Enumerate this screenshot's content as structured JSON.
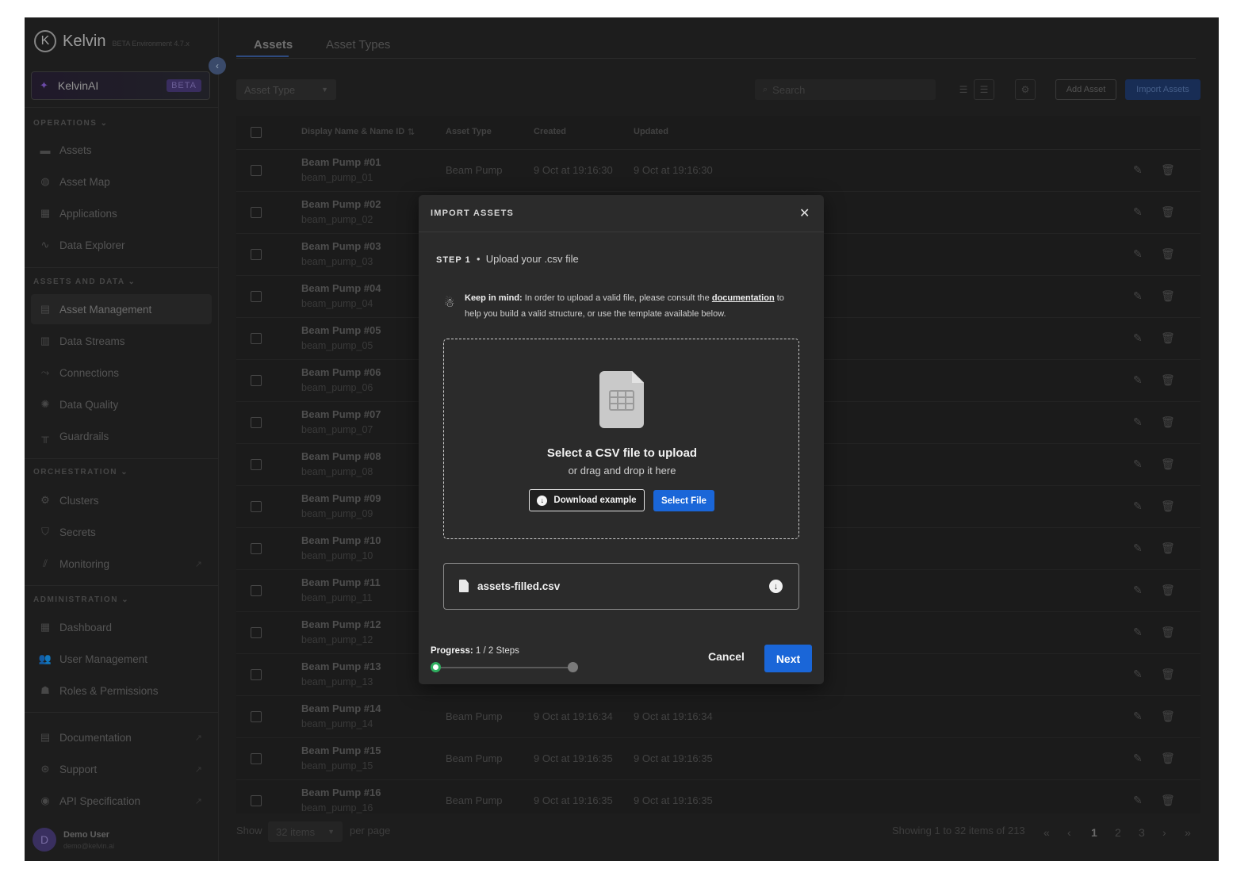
{
  "brand": {
    "logo_letter": "K",
    "name": "Kelvin",
    "subtitle": "BETA Environment 4.7.x"
  },
  "kelvin_ai": {
    "label": "KelvinAI",
    "badge": "BETA"
  },
  "sidebar": {
    "sections": {
      "operations": "OPERATIONS ⌄",
      "assets_data": "ASSETS AND DATA ⌄",
      "orchestration": "ORCHESTRATION ⌄",
      "administration": "ADMINISTRATION ⌄"
    },
    "items": [
      {
        "label": "Assets"
      },
      {
        "label": "Asset Map"
      },
      {
        "label": "Applications"
      },
      {
        "label": "Data Explorer"
      },
      {
        "label": "Asset Management"
      },
      {
        "label": "Data Streams"
      },
      {
        "label": "Connections"
      },
      {
        "label": "Data Quality"
      },
      {
        "label": "Guardrails"
      },
      {
        "label": "Clusters"
      },
      {
        "label": "Secrets"
      },
      {
        "label": "Monitoring"
      },
      {
        "label": "Dashboard"
      },
      {
        "label": "User Management"
      },
      {
        "label": "Roles & Permissions"
      },
      {
        "label": "Documentation"
      },
      {
        "label": "Support"
      },
      {
        "label": "API Specification"
      }
    ]
  },
  "user": {
    "initial": "D",
    "name": "Demo User",
    "email": "demo@kelvin.ai"
  },
  "tabs": [
    {
      "label": "Assets"
    },
    {
      "label": "Asset Types"
    }
  ],
  "toolbar": {
    "asset_type_filter": "Asset Type",
    "search_placeholder": "Search",
    "add_asset": "Add Asset",
    "import_assets": "Import Assets"
  },
  "table": {
    "headers": {
      "name": "Display Name & Name ID",
      "asset_type": "Asset Type",
      "created": "Created",
      "updated": "Updated"
    },
    "rows": [
      {
        "name": "Beam Pump #01",
        "id": "beam_pump_01",
        "type": "Beam Pump",
        "created": "9 Oct at 19:16:30",
        "updated": "9 Oct at 19:16:30"
      },
      {
        "name": "Beam Pump #02",
        "id": "beam_pump_02",
        "type": "",
        "created": "",
        "updated": ""
      },
      {
        "name": "Beam Pump #03",
        "id": "beam_pump_03",
        "type": "",
        "created": "",
        "updated": ""
      },
      {
        "name": "Beam Pump #04",
        "id": "beam_pump_04",
        "type": "",
        "created": "",
        "updated": ""
      },
      {
        "name": "Beam Pump #05",
        "id": "beam_pump_05",
        "type": "",
        "created": "",
        "updated": ""
      },
      {
        "name": "Beam Pump #06",
        "id": "beam_pump_06",
        "type": "",
        "created": "",
        "updated": ""
      },
      {
        "name": "Beam Pump #07",
        "id": "beam_pump_07",
        "type": "",
        "created": "",
        "updated": ""
      },
      {
        "name": "Beam Pump #08",
        "id": "beam_pump_08",
        "type": "",
        "created": "",
        "updated": ""
      },
      {
        "name": "Beam Pump #09",
        "id": "beam_pump_09",
        "type": "",
        "created": "",
        "updated": ""
      },
      {
        "name": "Beam Pump #10",
        "id": "beam_pump_10",
        "type": "",
        "created": "",
        "updated": ""
      },
      {
        "name": "Beam Pump #11",
        "id": "beam_pump_11",
        "type": "",
        "created": "",
        "updated": ""
      },
      {
        "name": "Beam Pump #12",
        "id": "beam_pump_12",
        "type": "",
        "created": "",
        "updated": ""
      },
      {
        "name": "Beam Pump #13",
        "id": "beam_pump_13",
        "type": "",
        "created": "",
        "updated": ""
      },
      {
        "name": "Beam Pump #14",
        "id": "beam_pump_14",
        "type": "Beam Pump",
        "created": "9 Oct at 19:16:34",
        "updated": "9 Oct at 19:16:34"
      },
      {
        "name": "Beam Pump #15",
        "id": "beam_pump_15",
        "type": "Beam Pump",
        "created": "9 Oct at 19:16:35",
        "updated": "9 Oct at 19:16:35"
      },
      {
        "name": "Beam Pump #16",
        "id": "beam_pump_16",
        "type": "Beam Pump",
        "created": "9 Oct at 19:16:35",
        "updated": "9 Oct at 19:16:35"
      }
    ]
  },
  "footer": {
    "show": "Show",
    "per_page_value": "32 items",
    "per_page": "per page",
    "showing": "Showing 1 to 32 items of 213",
    "pages": [
      "1",
      "2",
      "3"
    ]
  },
  "modal": {
    "title": "IMPORT ASSETS",
    "step_label": "STEP 1",
    "step_text": "Upload your .csv file",
    "note_bold": "Keep in mind:",
    "note_text": "In order to upload a valid file, please consult the",
    "note_link": "documentation",
    "note_text2": "to help you build a valid structure, or use the template available below.",
    "drop_title": "Select a CSV file to upload",
    "drop_sub": "or drag and drop it here",
    "download_example": "Download example",
    "select_file": "Select File",
    "file_name": "assets-filled.csv",
    "progress_label": "Progress:",
    "progress_value": "1 / 2 Steps",
    "progress_current": 1,
    "progress_total": 2,
    "cancel": "Cancel",
    "next": "Next"
  },
  "colors": {
    "accent": "#1a66d8",
    "progress": "#2fae5f",
    "background": "#262626"
  }
}
